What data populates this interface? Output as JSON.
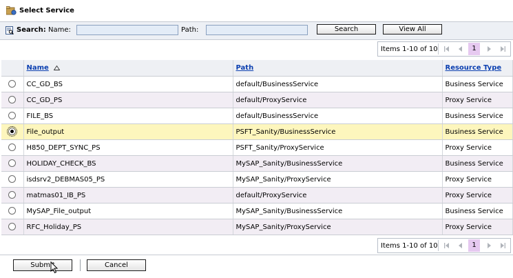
{
  "header": {
    "title": "Select Service",
    "icon": "service-folder-icon"
  },
  "search": {
    "label": "Search:",
    "name_label": "Name:",
    "name_value": "",
    "path_label": "Path:",
    "path_value": "",
    "search_button": "Search",
    "view_all_button": "View All"
  },
  "pager": {
    "text": "Items 1-10 of 10",
    "current_page": "1"
  },
  "table": {
    "columns": {
      "name": "Name",
      "path": "Path",
      "type": "Resource Type"
    },
    "rows": [
      {
        "name": "CC_GD_BS",
        "path": "default/BusinessService",
        "type": "Business Service",
        "selected": false
      },
      {
        "name": "CC_GD_PS",
        "path": "default/ProxyService",
        "type": "Proxy Service",
        "selected": false
      },
      {
        "name": "FILE_BS",
        "path": "default/BusinessService",
        "type": "Business Service",
        "selected": false
      },
      {
        "name": "File_output",
        "path": "PSFT_Sanity/BusinessService",
        "type": "Business Service",
        "selected": true
      },
      {
        "name": "H850_DEPT_SYNC_PS",
        "path": "PSFT_Sanity/ProxyService",
        "type": "Proxy Service",
        "selected": false
      },
      {
        "name": "HOLIDAY_CHECK_BS",
        "path": "MySAP_Sanity/BusinessService",
        "type": "Business Service",
        "selected": false
      },
      {
        "name": "isdsrv2_DEBMAS05_PS",
        "path": "MySAP_Sanity/ProxyService",
        "type": "Proxy Service",
        "selected": false
      },
      {
        "name": "matmas01_IB_PS",
        "path": "default/ProxyService",
        "type": "Proxy Service",
        "selected": false
      },
      {
        "name": "MySAP_File_output",
        "path": "MySAP_Sanity/BusinessService",
        "type": "Business Service",
        "selected": false
      },
      {
        "name": "RFC_Holiday_PS",
        "path": "MySAP_Sanity/ProxyService",
        "type": "Proxy Service",
        "selected": false
      }
    ]
  },
  "footer": {
    "submit_button": "Submit",
    "cancel_button": "Cancel"
  },
  "colors": {
    "selected_row": "#fdf6bd",
    "alt_row": "#f2edf4",
    "link": "#0b3fb0",
    "page_highlight": "#e6c9f0"
  }
}
